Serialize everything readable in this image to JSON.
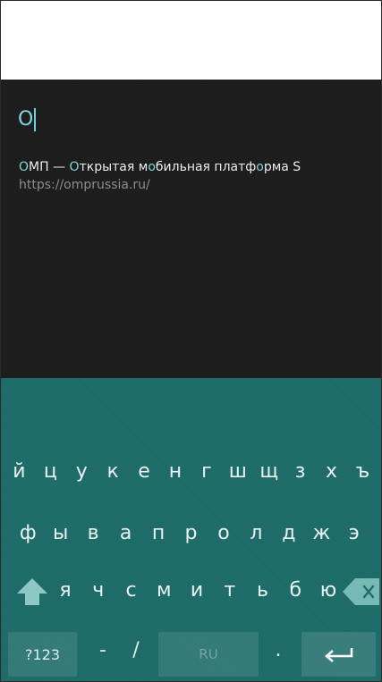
{
  "search": {
    "query": "О"
  },
  "suggestion": {
    "title_highlight_1": "О",
    "title_part_1": "МП — ",
    "title_highlight_2": "О",
    "title_part_2": "ткрытая м",
    "title_highlight_3": "о",
    "title_part_3": "бильная платф",
    "title_highlight_4": "о",
    "title_part_4": "рма S",
    "url": "https://omprussia.ru/"
  },
  "keyboard": {
    "row1": [
      "й",
      "ц",
      "у",
      "к",
      "е",
      "н",
      "г",
      "ш",
      "щ",
      "з",
      "х",
      "ъ"
    ],
    "row2": [
      "ф",
      "ы",
      "в",
      "а",
      "п",
      "р",
      "о",
      "л",
      "д",
      "ж",
      "э"
    ],
    "row3": [
      "я",
      "ч",
      "с",
      "м",
      "и",
      "т",
      "ь",
      "б",
      "ю"
    ],
    "symbols_label": "?123",
    "dash": "-",
    "slash": "/",
    "language": "RU",
    "dot": ".",
    "icons": {
      "shift": "shift-arrow-up-icon",
      "backspace": "backspace-icon",
      "enter": "enter-return-icon"
    }
  },
  "colors": {
    "accent": "#7fd6da",
    "keyboard_bg": "#1f6e6b",
    "panel_bg": "#1c1c1c"
  }
}
